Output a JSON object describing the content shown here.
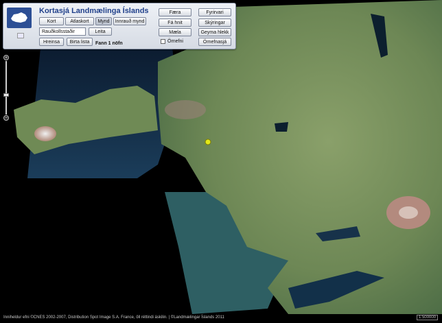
{
  "app": {
    "title": "Kortasjá Landmælinga Íslands"
  },
  "map_tabs": [
    {
      "label": "Kort"
    },
    {
      "label": "Atlaskort"
    },
    {
      "label": "Mynd"
    },
    {
      "label": "Innrauð mynd"
    }
  ],
  "search": {
    "value": "Rauðkollsstaðir",
    "button": "Leita",
    "clear_button": "Hreinsa",
    "list_button": "Birta lista",
    "result_text": "Fann 1 nöfn"
  },
  "right_buttons": {
    "col1": [
      "Færa",
      "Fá hnit",
      "Mæla"
    ],
    "col2": [
      "Fyrirvari",
      "Skýringar",
      "Geyma hlekk",
      "Örnefnasjá"
    ]
  },
  "option": {
    "label": "Örnefni"
  },
  "footer": {
    "credits": "Inniheldur efni ©CNES 2002-2007, Distribution Spot Image S.A. France, öll réttindi áskilin. | ©Landmælingar Íslands 2011",
    "scale": "1:500000"
  },
  "icons": {
    "logo": "iceland-logo-icon",
    "flag": "uk-flag-icon",
    "marker": "location-marker-icon"
  },
  "colors": {
    "title": "#1f3f8a",
    "marker": "#e3e81a",
    "water": "#0d2a48",
    "land": "#6f8a55"
  }
}
